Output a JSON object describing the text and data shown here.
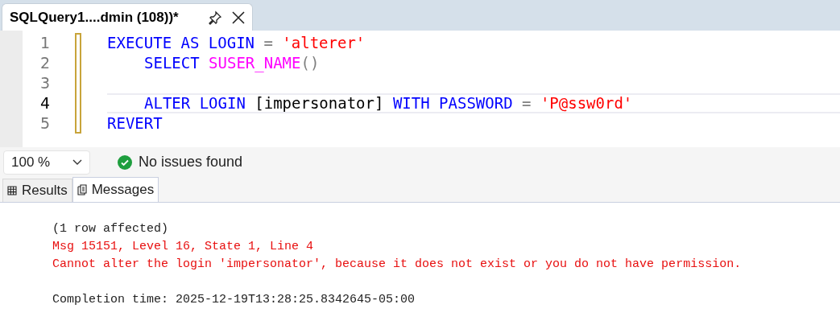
{
  "tab": {
    "title": "SQLQuery1....dmin (108))*"
  },
  "editor": {
    "lines": [
      {
        "number": "1",
        "current": false,
        "indented": false,
        "tokens": [
          {
            "kind": "keyword",
            "text": "EXECUTE AS LOGIN"
          },
          {
            "kind": "operator",
            "text": " = "
          },
          {
            "kind": "string",
            "text": "'alterer'"
          }
        ]
      },
      {
        "number": "2",
        "current": false,
        "indented": true,
        "tokens": [
          {
            "kind": "keyword",
            "text": "SELECT "
          },
          {
            "kind": "function",
            "text": "SUSER_NAME"
          },
          {
            "kind": "operator",
            "text": "()"
          }
        ]
      },
      {
        "number": "3",
        "current": false
      },
      {
        "number": "4",
        "current": true,
        "indented": true,
        "tokens": [
          {
            "kind": "keyword",
            "text": "ALTER LOGIN"
          },
          {
            "kind": "plain",
            "text": " [impersonator] "
          },
          {
            "kind": "keyword",
            "text": "WITH PASSWORD"
          },
          {
            "kind": "operator",
            "text": " = "
          },
          {
            "kind": "string",
            "text": "'P@ssw0rd'"
          }
        ]
      },
      {
        "number": "5",
        "current": false,
        "indented": false,
        "tokens": [
          {
            "kind": "keyword",
            "text": "REVERT"
          }
        ]
      }
    ]
  },
  "zoom": {
    "value": "100 %"
  },
  "status": {
    "text": "No issues found"
  },
  "result_tabs": [
    {
      "label": "Results",
      "selected": false
    },
    {
      "label": "Messages",
      "selected": true
    }
  ],
  "messages": [
    {
      "kind": "info",
      "text": "(1 row affected)"
    },
    {
      "kind": "error",
      "text": "Msg 15151, Level 16, State 1, Line 4"
    },
    {
      "kind": "error",
      "text": "Cannot alter the login 'impersonator', because it does not exist or you do not have permission."
    },
    {
      "kind": "blank"
    },
    {
      "kind": "info",
      "text": "Completion time: 2025-12-19T13:28:25.8342645-05:00"
    }
  ]
}
